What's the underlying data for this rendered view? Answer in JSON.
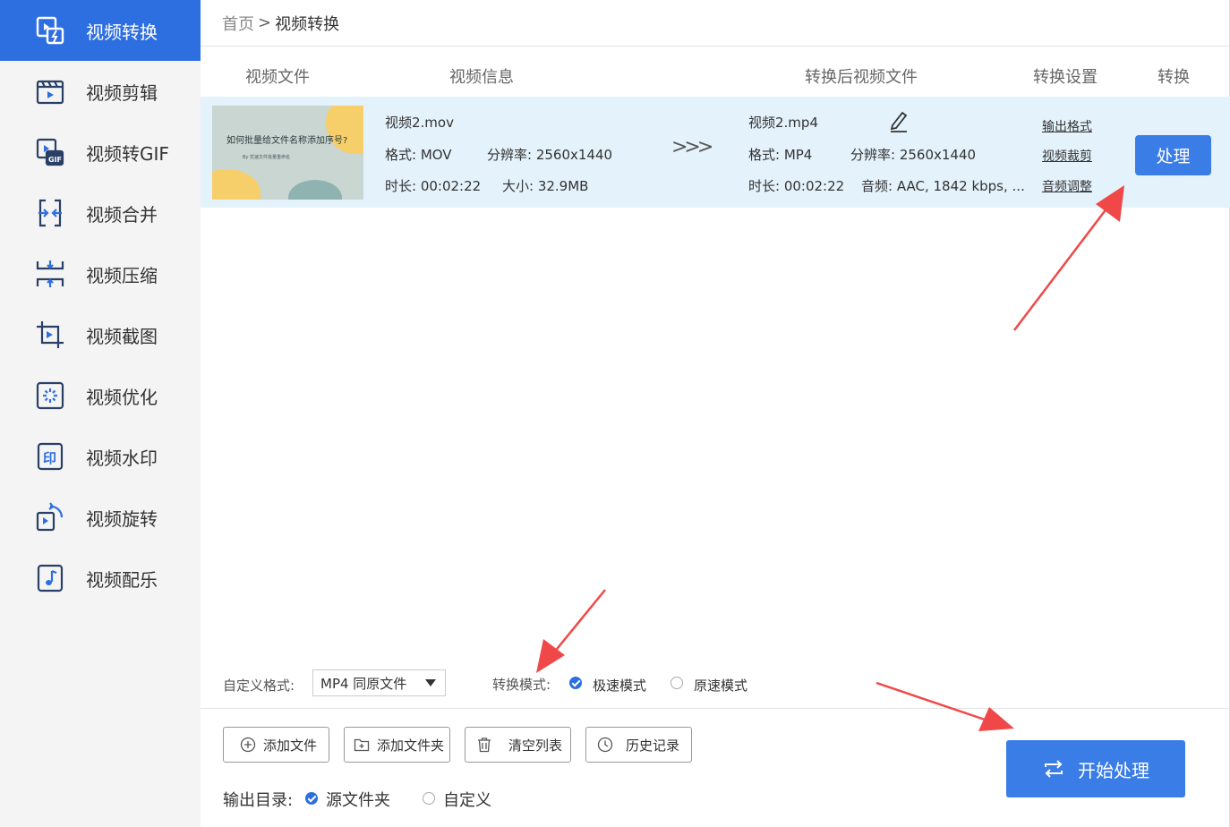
{
  "sidebar": {
    "items": [
      {
        "label": "视频转换",
        "icon": "video-convert-icon"
      },
      {
        "label": "视频剪辑",
        "icon": "clapperboard-icon"
      },
      {
        "label": "视频转GIF",
        "icon": "gif-convert-icon"
      },
      {
        "label": "视频合并",
        "icon": "merge-icon"
      },
      {
        "label": "视频压缩",
        "icon": "compress-icon"
      },
      {
        "label": "视频截图",
        "icon": "crop-icon"
      },
      {
        "label": "视频优化",
        "icon": "sparkle-icon"
      },
      {
        "label": "视频水印",
        "icon": "stamp-icon"
      },
      {
        "label": "视频旋转",
        "icon": "rotate-icon"
      },
      {
        "label": "视频配乐",
        "icon": "music-note-icon"
      }
    ],
    "active_index": 0
  },
  "breadcrumb": {
    "home": "首页",
    "separator": ">",
    "current": "视频转换"
  },
  "columns": {
    "file": "视频文件",
    "info": "视频信息",
    "output": "转换后视频文件",
    "settings": "转换设置",
    "convert": "转换"
  },
  "file_row": {
    "thumbnail_title": "如何批量给文件名称添加序号?",
    "thumbnail_subtitle": "By 优速文件批量重命名",
    "source": {
      "name": "视频2.mov",
      "format": "格式: MOV",
      "resolution": "分辨率: 2560x1440",
      "duration": "时长: 00:02:22",
      "size": "大小: 32.9MB"
    },
    "arrow": ">>>",
    "target": {
      "name": "视频2.mp4",
      "format": "格式: MP4",
      "resolution": "分辨率: 2560x1440",
      "duration": "时长: 00:02:22",
      "audio": "音频: AAC, 1842 kbps, ..."
    },
    "settings_links": [
      "输出格式",
      "视频裁剪",
      "音频调整"
    ],
    "process_label": "处理"
  },
  "options": {
    "format_label": "自定义格式:",
    "format_value": "MP4 同原文件",
    "mode_label": "转换模式:",
    "mode_fast": "极速模式",
    "mode_original": "原速模式",
    "mode_selected": "fast"
  },
  "toolbar": {
    "add_file": "添加文件",
    "add_folder": "添加文件夹",
    "clear_list": "清空列表",
    "history": "历史记录"
  },
  "start_label": "开始处理",
  "output_dir": {
    "label": "输出目录:",
    "source_folder": "源文件夹",
    "custom": "自定义",
    "selected": "source_folder"
  },
  "colors": {
    "accent": "#2d6ee0",
    "button": "#3b7de6",
    "row_highlight": "#e4f2fc",
    "annotation_arrow": "#f04848"
  }
}
